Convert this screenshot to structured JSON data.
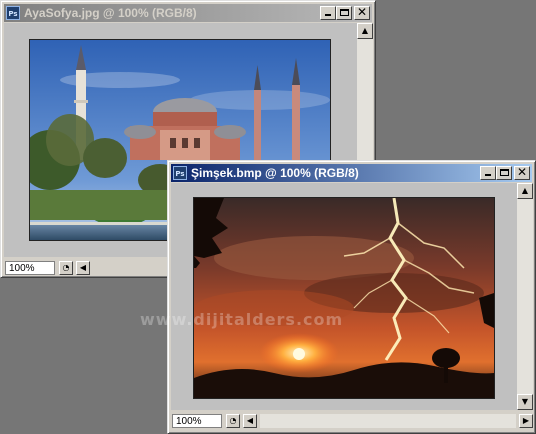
{
  "window1": {
    "title": "AyaSofya.jpg @ 100% (RGB/8)",
    "app_icon_label": "Ps",
    "zoom": "100%",
    "image_subject": "Hagia Sophia photograph"
  },
  "window2": {
    "title": "Şimşek.bmp @ 100% (RGB/8)",
    "app_icon_label": "Ps",
    "zoom": "100%",
    "image_subject": "lightning over sunset photograph"
  },
  "watermark": "www.dijitalders.com",
  "colors": {
    "desktop": "#767676",
    "active_title_start": "#0a246a",
    "active_title_end": "#a6caf0",
    "inactive_title_start": "#808080",
    "inactive_title_end": "#b9b9b9"
  }
}
